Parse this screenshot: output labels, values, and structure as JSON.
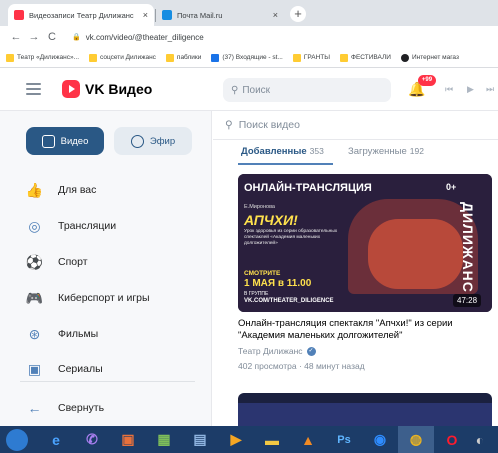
{
  "browser": {
    "tabs": [
      {
        "title": "Видеозаписи Театр Дилижанс",
        "close": "×",
        "favicon_color": "#ff3347"
      },
      {
        "title": "Почта Mail.ru",
        "close": "×",
        "favicon_color": "#168de2"
      }
    ],
    "new_tab": "+",
    "nav": {
      "back": "←",
      "forward": "→",
      "reload": "C"
    },
    "url": "vk.com/video/@theater_diligence",
    "bookmarks": [
      {
        "label": "Театр «Дилижанс»...",
        "color": "#ffcc33"
      },
      {
        "label": "соцсети Дилижанс",
        "color": "#ffcc33"
      },
      {
        "label": "паблики",
        "color": "#ffcc33"
      },
      {
        "label": "(37) Входящие - st...",
        "color": "#1a73e8"
      },
      {
        "label": "ГРАНТЫ",
        "color": "#ffcc33"
      },
      {
        "label": "ФЕСТИВАЛИ",
        "color": "#ffcc33"
      },
      {
        "label": "Интернет магаз",
        "color": "#202124"
      }
    ]
  },
  "header": {
    "logo_text": "VK Видео",
    "search_placeholder": "Поиск",
    "notifications_badge": "+99"
  },
  "sidebar": {
    "video_button": "Видео",
    "live_button": "Эфир",
    "items": [
      {
        "label": "Для вас",
        "icon": "thumbs-up-icon",
        "glyph": "👍"
      },
      {
        "label": "Трансляции",
        "icon": "broadcast-icon",
        "glyph": "◎"
      },
      {
        "label": "Спорт",
        "icon": "ball-icon",
        "glyph": "⚽"
      },
      {
        "label": "Киберспорт и игры",
        "icon": "gamepad-icon",
        "glyph": "🎮"
      },
      {
        "label": "Фильмы",
        "icon": "film-reel-icon",
        "glyph": "⊛"
      },
      {
        "label": "Сериалы",
        "icon": "series-icon",
        "glyph": "▣"
      }
    ],
    "collapse_label": "Свернуть",
    "collapse_glyph": "←"
  },
  "content": {
    "search_placeholder": "Поиск видео",
    "subtabs": {
      "added_label": "Добавленные",
      "added_count": "353",
      "uploaded_label": "Загруженные",
      "uploaded_count": "192"
    },
    "video": {
      "thumb": {
        "live": "ОНЛАЙН-ТРАНСЛЯЦИЯ",
        "age": "0+",
        "author": "Е.Миронова",
        "show": "АПЧХИ!",
        "desc": "Урок здоровья из серии образовательных спектаклей «Академия маленьких долгожителей»",
        "watch": "СМОТРИТЕ",
        "date": "1 МАЯ в 11.00",
        "group": "В ГРУППЕ",
        "link": "VK.COM/THEATER_DILIGENCE",
        "brand": "ДИЛИЖАНС",
        "duration": "47:28"
      },
      "title": "Онлайн-трансляция спектакля \"Апчхи!\" из серии \"Академия маленьких долгожителей\"",
      "channel": "Театр Дилижанс",
      "verified": "✓",
      "meta": "402 просмотра · 48 минут назад"
    }
  },
  "taskbar": {
    "items": [
      {
        "icon": "ie-icon",
        "glyph": "e",
        "color": "#4aa3ff"
      },
      {
        "icon": "viber-icon",
        "glyph": "✆",
        "color": "#a97ff0"
      },
      {
        "icon": "media-icon",
        "glyph": "▣",
        "color": "#e8713c"
      },
      {
        "icon": "photo-icon",
        "glyph": "▦",
        "color": "#7fbf5a"
      },
      {
        "icon": "explorer-icon",
        "glyph": "▤",
        "color": "#8fb4e0"
      },
      {
        "icon": "player-icon",
        "glyph": "▶",
        "color": "#f5a623"
      },
      {
        "icon": "folder-icon",
        "glyph": "▬",
        "color": "#f2c744"
      },
      {
        "icon": "vlc-icon",
        "glyph": "▲",
        "color": "#f08a24"
      },
      {
        "icon": "ps-icon",
        "glyph": "Ps",
        "color": "#5fb5ff"
      },
      {
        "icon": "opera-gx-icon",
        "glyph": "◉",
        "color": "#2e8cff"
      },
      {
        "icon": "chrome-icon",
        "glyph": "◍",
        "color": "#e9b322"
      },
      {
        "icon": "opera-icon",
        "glyph": "O",
        "color": "#ff1b2d"
      },
      {
        "icon": "misc-icon",
        "glyph": "◐",
        "color": "#cccccc"
      }
    ]
  }
}
